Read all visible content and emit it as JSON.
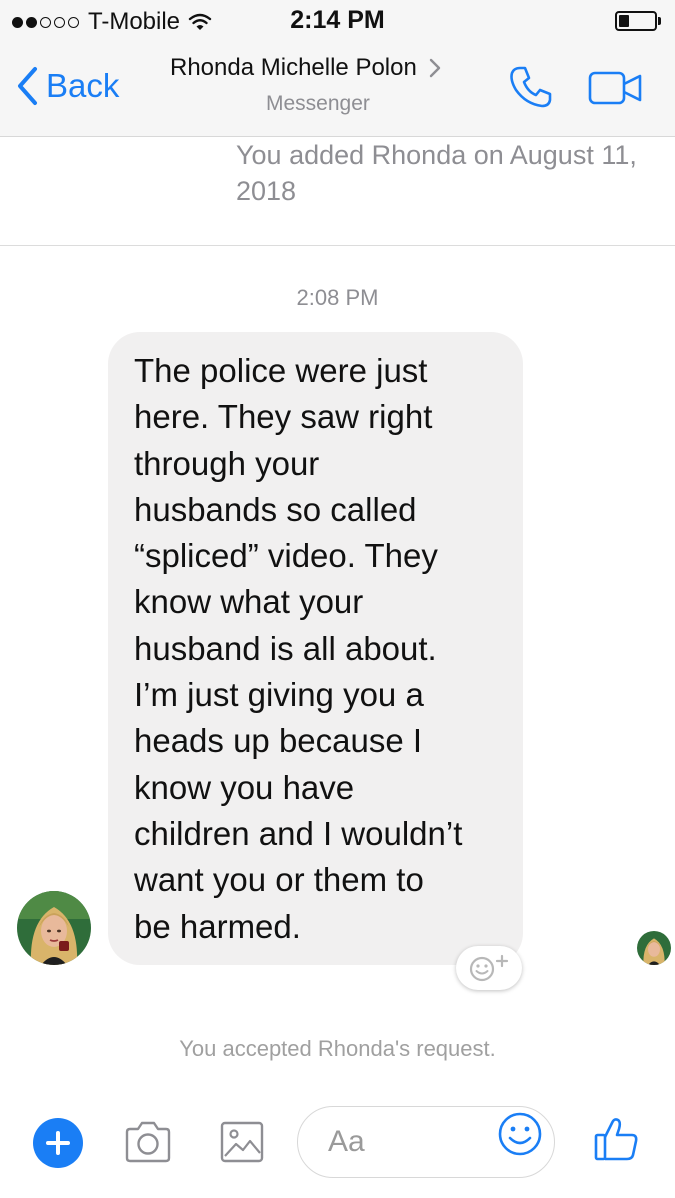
{
  "status_bar": {
    "carrier": "T-Mobile",
    "time": "2:14 PM",
    "signal_bars_filled": 2,
    "signal_bars_total": 5,
    "battery_level": 0.3
  },
  "nav": {
    "back_label": "Back",
    "contact_name": "Rhonda Michelle Polon",
    "contact_subtitle": "Messenger",
    "icons": [
      "chevron-left-icon",
      "chevron-right-icon",
      "phone-icon",
      "video-camera-icon"
    ]
  },
  "thread": {
    "added_note": "You added Rhonda on August 11, 2018",
    "message_time": "2:08 PM",
    "message_text": "The police were just\nhere. They saw right\nthrough your\nhusbands so called\n“spliced” video.  They\nknow what your\nhusband is all about.\nI’m just giving you a\nheads up because I\nknow you have\nchildren and I wouldn’t\nwant you or them to\nbe harmed.",
    "reaction_icon": "emoji-plus-icon",
    "accepted_note": "You accepted Rhonda's request."
  },
  "composer": {
    "placeholder": "Aa",
    "icons": [
      "plus-icon",
      "camera-icon",
      "image-icon",
      "smiley-icon",
      "thumbs-up-icon"
    ]
  },
  "colors": {
    "accent": "#1a7ef5",
    "bubble": "#f1f0f0",
    "bar_background": "#f6f6f6",
    "muted_text": "#8e8e93"
  }
}
